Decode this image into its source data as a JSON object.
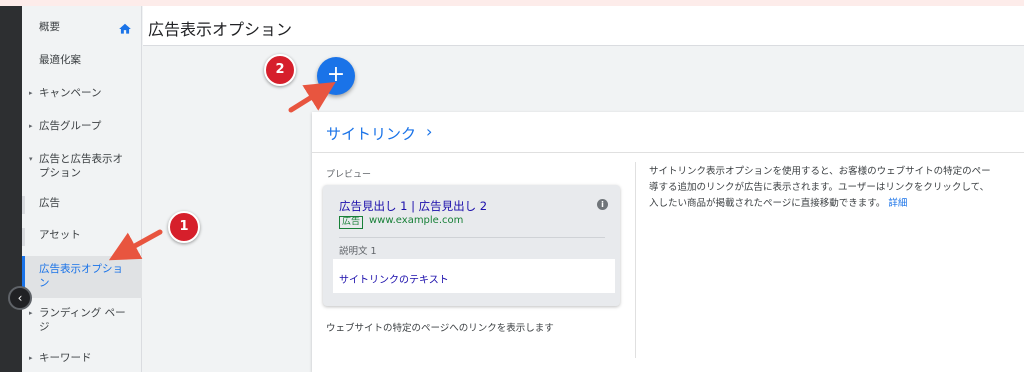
{
  "header": {
    "title": "広告表示オプション"
  },
  "sidebar": {
    "items": [
      {
        "label": "概要"
      },
      {
        "label": "最適化案"
      },
      {
        "label": "キャンペーン"
      },
      {
        "label": "広告グループ"
      },
      {
        "label": "広告と広告表示オ",
        "label2": "プション"
      },
      {
        "label": "広告"
      },
      {
        "label": "アセット"
      },
      {
        "label": "広告表示オプショ",
        "label2": "ン"
      },
      {
        "label": "ランディング ペー",
        "label2": "ジ"
      },
      {
        "label": "キーワード"
      }
    ]
  },
  "annotations": {
    "badge1": "1",
    "badge2": "2"
  },
  "fab": {
    "label": "+"
  },
  "card": {
    "title": "サイトリンク",
    "chevron": "›",
    "preview_label": "プレビュー",
    "ad": {
      "headline": "広告見出し 1 | 広告見出し 2",
      "badge": "広告",
      "url": "www.example.com",
      "description": "説明文 1",
      "sitelink": "サイトリンクのテキスト"
    },
    "footer": "ウェブサイトの特定のページへのリンクを表示します",
    "description_lines": [
      "サイトリンク表示オプションを使用すると、お客様のウェブサイトの特定のペー",
      "導する追加のリンクが広告に表示されます。ユーザーはリンクをクリックして、",
      "入したい商品が掲載されたページに直接移動できます。"
    ],
    "details_link": "詳細"
  },
  "colors": {
    "accent": "#1a73e8",
    "annotation": "#d61f2b",
    "ad_link": "#1a0dab",
    "ad_green": "#188038"
  },
  "icons": {
    "home": "home-icon",
    "collapse": "chevron-left-icon",
    "info": "info-icon"
  }
}
